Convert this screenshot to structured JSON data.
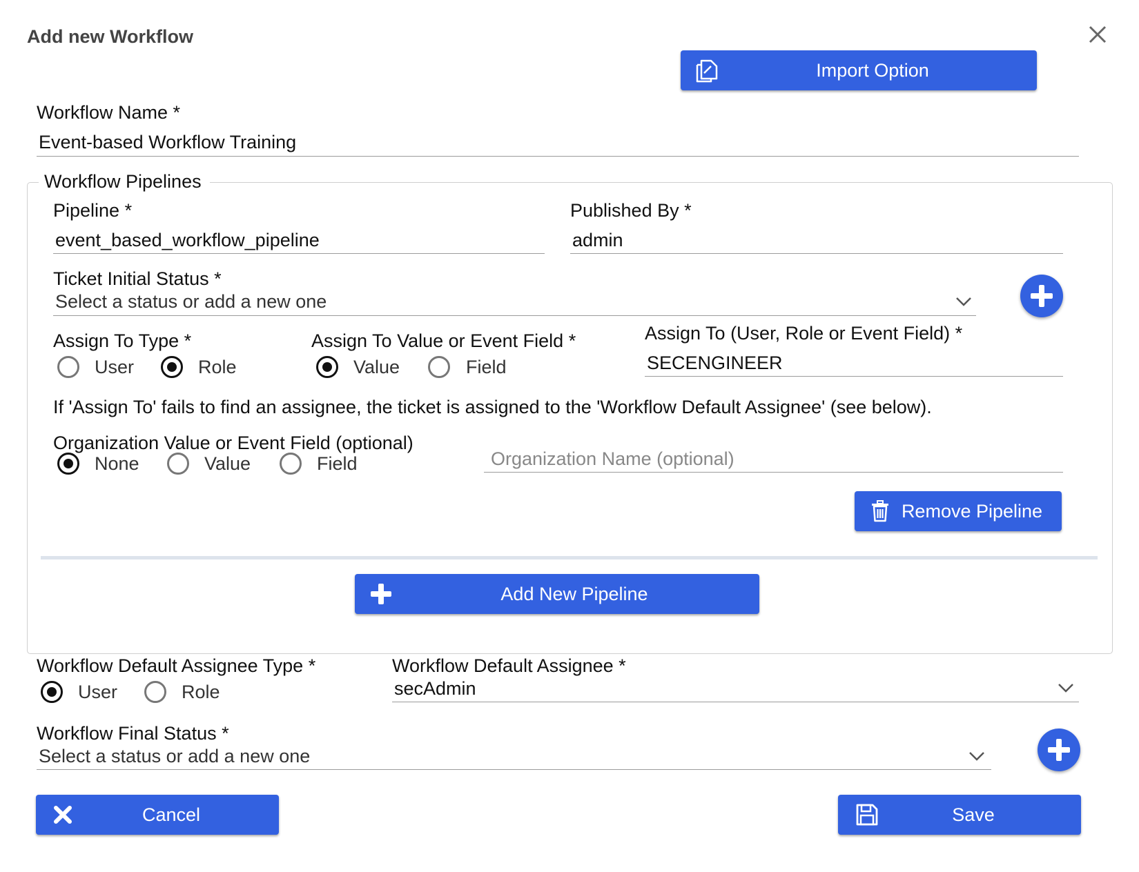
{
  "dialog": {
    "title": "Add new Workflow",
    "close_icon": "close-icon"
  },
  "import_button": {
    "label": "Import Option",
    "icon": "copy-icon"
  },
  "workflow_name": {
    "label": "Workflow Name *",
    "value": "Event-based Workflow Training"
  },
  "pipelines": {
    "legend": "Workflow Pipelines",
    "pipeline": {
      "label": "Pipeline *",
      "value": "event_based_workflow_pipeline"
    },
    "published_by": {
      "label": "Published By *",
      "value": "admin"
    },
    "ticket_initial_status": {
      "label": "Ticket Initial Status *",
      "placeholder": "Select a status or add a new one"
    },
    "assign_to_type": {
      "label": "Assign To Type *",
      "options": [
        "User",
        "Role"
      ],
      "selected": "Role"
    },
    "assign_to_value": {
      "label": "Assign To Value or Event Field *",
      "options": [
        "Value",
        "Field"
      ],
      "selected": "Value"
    },
    "assign_to": {
      "label": "Assign To (User, Role or Event Field) *",
      "value": "SECENGINEER"
    },
    "note": "If 'Assign To' fails to find an assignee, the ticket is assigned to the 'Workflow Default Assignee' (see below).",
    "organization": {
      "label": "Organization Value or Event Field (optional)",
      "options": [
        "None",
        "Value",
        "Field"
      ],
      "selected": "None",
      "name_placeholder": "Organization Name (optional)"
    },
    "remove_button": {
      "label": "Remove Pipeline",
      "icon": "trash-icon"
    },
    "add_button": {
      "label": "Add New Pipeline",
      "icon": "plus-icon"
    }
  },
  "default_assignee_type": {
    "label": "Workflow Default Assignee Type *",
    "options": [
      "User",
      "Role"
    ],
    "selected": "User"
  },
  "default_assignee": {
    "label": "Workflow Default Assignee *",
    "value": "secAdmin"
  },
  "final_status": {
    "label": "Workflow Final Status *",
    "placeholder": "Select a status or add a new one"
  },
  "footer": {
    "cancel_label": "Cancel",
    "cancel_icon": "x-icon",
    "save_label": "Save",
    "save_icon": "floppy-disk-icon"
  },
  "colors": {
    "accent": "#3361e0",
    "text": "#111111",
    "underline": "#9b9b9b"
  }
}
